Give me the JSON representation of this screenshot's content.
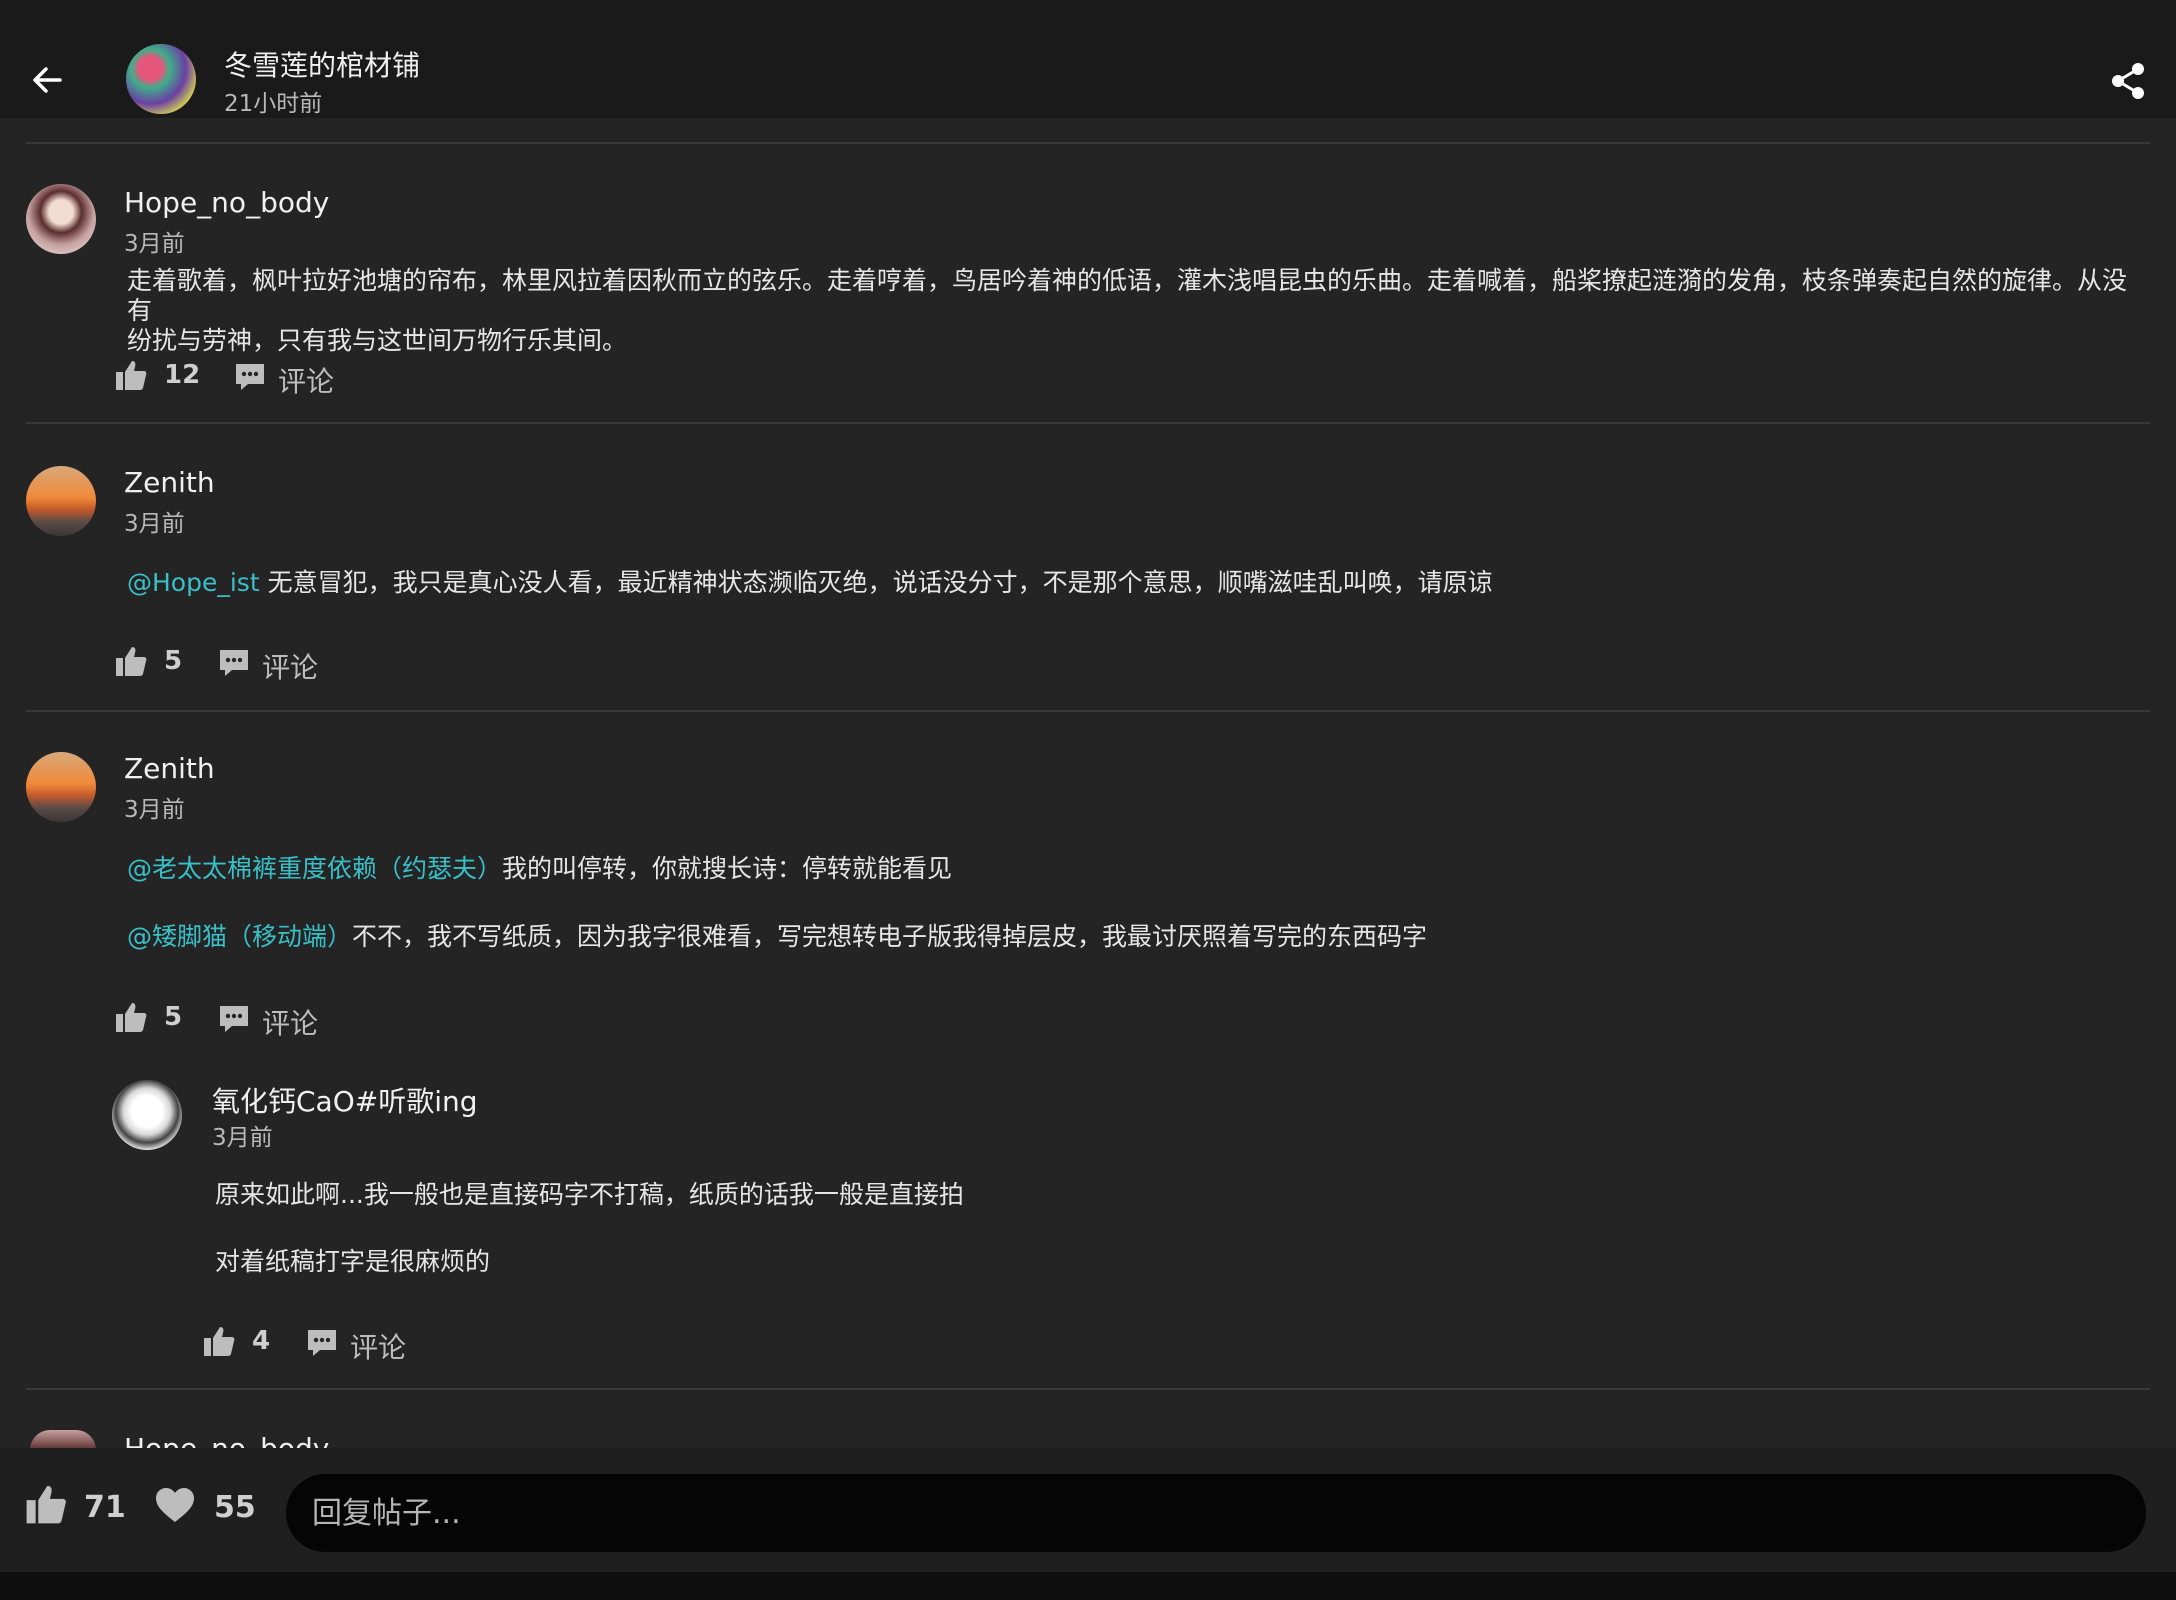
{
  "header": {
    "title": "冬雪莲的棺材铺",
    "time": "21小时前"
  },
  "comments": [
    {
      "user": "Hope_no_body",
      "time": "3月前",
      "lines": [
        "走着歌着，枫叶拉好池塘的帘布，林里风拉着因秋而立的弦乐。走着哼着，鸟居吟着神的低语，灌木浅唱昆虫的乐曲。走着喊着，船桨撩起涟漪的发角，枝条弹奏起自然的旋律。从没有",
        "纷扰与劳神，只有我与这世间万物行乐其间。"
      ],
      "likes": "12",
      "comment_label": "评论"
    },
    {
      "user": "Zenith",
      "time": "3月前",
      "mention": "@Hope_ist",
      "text": " 无意冒犯，我只是真心没人看，最近精神状态濒临灭绝，说话没分寸，不是那个意思，顺嘴滋哇乱叫唤，请原谅",
      "likes": "5",
      "comment_label": "评论"
    },
    {
      "user": "Zenith",
      "time": "3月前",
      "paragraphs": [
        {
          "mention": "@老太太棉裤重度依赖（约瑟夫）",
          "text": "我的叫停转，你就搜长诗：停转就能看见"
        },
        {
          "mention": "@矮脚猫（移动端）",
          "text": "不不，我不写纸质，因为我字很难看，写完想转电子版我得掉层皮，我最讨厌照着写完的东西码字"
        }
      ],
      "likes": "5",
      "comment_label": "评论",
      "reply": {
        "user": "氧化钙CaO#听歌ing",
        "time": "3月前",
        "paragraphs": [
          "原来如此啊...我一般也是直接码字不打稿，纸质的话我一般是直接拍",
          "对着纸稿打字是很麻烦的"
        ],
        "likes": "4",
        "comment_label": "评论"
      }
    }
  ],
  "peek": {
    "user": "Hope_no_body"
  },
  "footer": {
    "likes": "71",
    "favorites": "55",
    "reply_placeholder": "回复帖子..."
  },
  "colors": {
    "mention": "#39bfc8",
    "background": "#242424",
    "topbar": "#1a1a1a"
  }
}
